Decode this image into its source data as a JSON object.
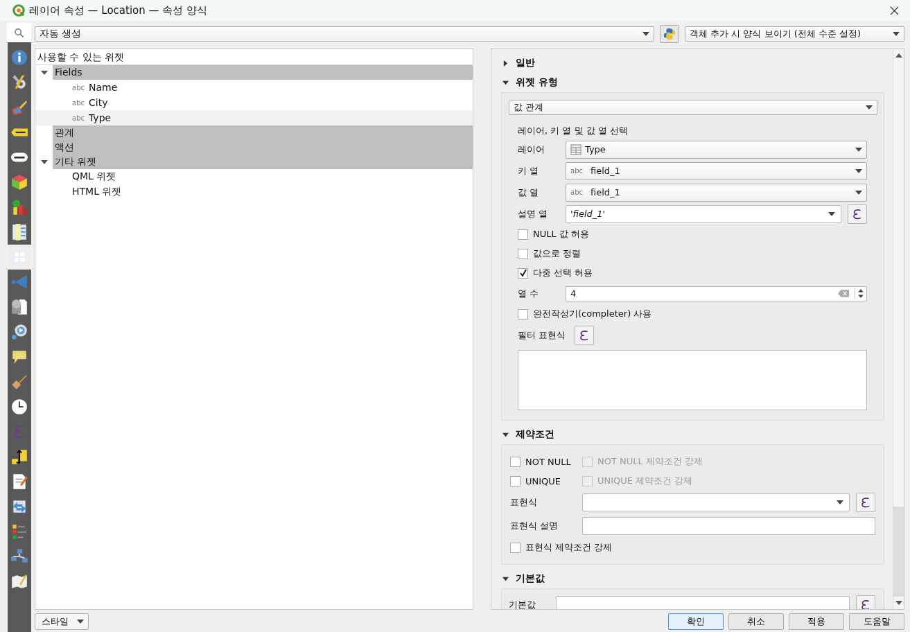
{
  "window": {
    "title": "레이어 속성 — Location — 속성 양식"
  },
  "sidebar": {
    "items": [
      {
        "selected": false
      },
      {
        "selected": false
      },
      {
        "selected": false
      },
      {
        "selected": false
      },
      {
        "selected": false
      },
      {
        "selected": false
      },
      {
        "selected": false
      },
      {
        "selected": false
      },
      {
        "selected": true
      },
      {
        "selected": false
      },
      {
        "selected": false
      },
      {
        "selected": false
      },
      {
        "selected": false
      },
      {
        "selected": false
      },
      {
        "selected": false
      },
      {
        "selected": false
      },
      {
        "selected": false
      },
      {
        "selected": false
      },
      {
        "selected": false
      },
      {
        "selected": false
      },
      {
        "selected": false
      },
      {
        "selected": false
      }
    ]
  },
  "form_mode": {
    "value": "자동 생성"
  },
  "suppress_mode": {
    "value": "객체 추가 시 양식 보이기 (전체 수준 설정)"
  },
  "widget_tree": {
    "header": "사용할 수 있는 위젯",
    "items": [
      {
        "label": "Fields",
        "kind": "group",
        "expanded": true,
        "children": [
          {
            "label": "Name",
            "tag": "abc",
            "selected": false
          },
          {
            "label": "City",
            "tag": "abc",
            "selected": false
          },
          {
            "label": "Type",
            "tag": "abc",
            "selected": true
          }
        ]
      },
      {
        "label": "관계",
        "kind": "group"
      },
      {
        "label": "액션",
        "kind": "group"
      },
      {
        "label": "기타 위젯",
        "kind": "group",
        "expanded": true,
        "children": [
          {
            "label": "QML 위젯",
            "selected": false
          },
          {
            "label": "HTML 위젯",
            "selected": false
          }
        ]
      }
    ]
  },
  "general_section": {
    "title": "일반",
    "expanded": false
  },
  "widget_type_section": {
    "title": "위젯 유형",
    "expanded": true,
    "widget_type": "값 관계",
    "caption": "레이어, 키 열 및 값 열 선택",
    "rows": [
      {
        "kind": "layer_combo",
        "label": "레이어",
        "value": "Type"
      },
      {
        "kind": "field_combo",
        "label": "키 열",
        "tag": "abc",
        "value": "field_1"
      },
      {
        "kind": "field_combo",
        "label": "값 열",
        "tag": "abc",
        "value": "field_1"
      },
      {
        "kind": "expression_combo",
        "label": "설명 열",
        "value": "'field_1'"
      },
      {
        "kind": "checkbox",
        "label": "NULL 값 허용",
        "checked": false
      },
      {
        "kind": "checkbox",
        "label": "값으로 정렬",
        "checked": false
      },
      {
        "kind": "checkbox",
        "label": "다중 선택 허용",
        "checked": true
      },
      {
        "kind": "spin",
        "label": "열 수",
        "value": "4"
      },
      {
        "kind": "checkbox",
        "label": "완전작성기(completer) 사용",
        "checked": false
      },
      {
        "kind": "expression_button",
        "label": "필터 표현식"
      },
      {
        "kind": "textarea"
      }
    ]
  },
  "constraints_section": {
    "title": "제약조건",
    "expanded": true,
    "checks": [
      {
        "label": "NOT NULL",
        "checked": false,
        "enforce_label": "NOT NULL 제약조건 강제",
        "enforce_checked": false,
        "enforce_disabled": true
      },
      {
        "label": "UNIQUE",
        "checked": false,
        "enforce_label": "UNIQUE 제약조건 강제",
        "enforce_checked": false,
        "enforce_disabled": true
      }
    ],
    "expression_label": "표현식",
    "description_label": "표현식 설명",
    "enforce_expression": {
      "label": "표현식 제약조건 강제",
      "checked": false
    }
  },
  "default_section": {
    "title": "기본값",
    "expanded": true,
    "label": "기본값"
  },
  "style_button": "스타일",
  "buttons": [
    {
      "label": "확인",
      "default": true
    },
    {
      "label": "취소",
      "default": false
    },
    {
      "label": "적용",
      "default": false
    },
    {
      "label": "도움말",
      "default": false
    }
  ]
}
